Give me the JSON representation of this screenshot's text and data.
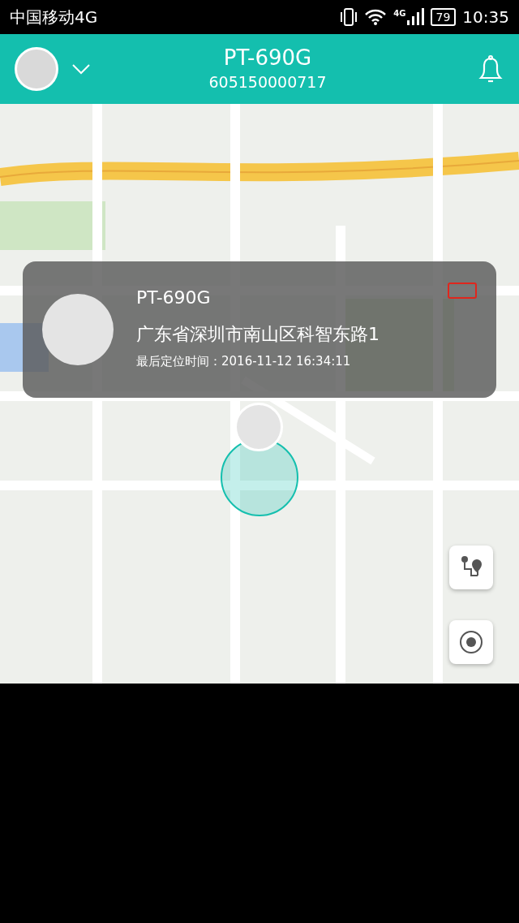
{
  "status_bar": {
    "carrier": "中国移动4G",
    "network": "4G",
    "battery": "79",
    "time": "10:35"
  },
  "header": {
    "device_name": "PT-690G",
    "device_id": "605150000717"
  },
  "info_card": {
    "device_name": "PT-690G",
    "address": "广东省深圳市南山区科智东路1",
    "last_fix": "最后定位时间：2016-11-12 16:34:11",
    "battery": {
      "level": 0
    }
  }
}
